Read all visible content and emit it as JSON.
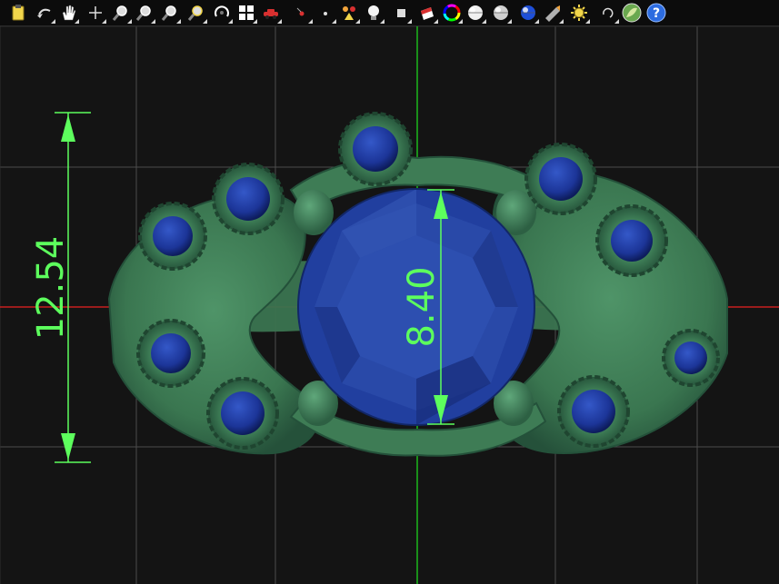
{
  "toolbar": {
    "items": [
      {
        "name": "clipboard-icon",
        "color": "#f2d64b"
      },
      {
        "name": "undo-arrow-icon",
        "color": "#dddddd"
      },
      {
        "name": "pan-hand-icon",
        "color": "#ffffff"
      },
      {
        "name": "move-cross-icon",
        "color": "#dddddd"
      },
      {
        "name": "zoom-in-icon",
        "color": "#ffffff"
      },
      {
        "name": "zoom-out-icon",
        "color": "#ffffff"
      },
      {
        "name": "zoom-extents-icon",
        "color": "#ffffff"
      },
      {
        "name": "zoom-selected-icon",
        "color": "#f2d64b"
      },
      {
        "name": "orbit-icon",
        "color": "#ffffff"
      },
      {
        "name": "four-viewports-icon",
        "color": "#ffffff"
      },
      {
        "name": "car-walk-icon",
        "color": "#d83030"
      },
      {
        "name": "point-icon",
        "color": "#d83030"
      },
      {
        "name": "dot-icon",
        "color": "#dddddd"
      },
      {
        "name": "snap-shapes-icon",
        "color": "#f2a43b"
      },
      {
        "name": "lightbulb-icon",
        "color": "#f4f4f4"
      },
      {
        "name": "shaded-box-icon",
        "color": "#dddddd"
      },
      {
        "name": "paint-bucket-icon",
        "color": "#d83030"
      },
      {
        "name": "color-wheel-icon",
        "color": "#ff00ff"
      },
      {
        "name": "white-sphere-icon",
        "color": "#f0f0f0"
      },
      {
        "name": "chrome-sphere-icon",
        "color": "#d0d0d0"
      },
      {
        "name": "blue-sphere-icon",
        "color": "#1e4fd8"
      },
      {
        "name": "metal-cone-icon",
        "color": "#b0b0b0"
      },
      {
        "name": "settings-sun-icon",
        "color": "#f2d64b"
      },
      {
        "name": "rotate-view-icon",
        "color": "#dddddd"
      },
      {
        "name": "render-leaf-icon",
        "color": "#6aa84f"
      },
      {
        "name": "help-icon",
        "color": "#2d6ce0"
      }
    ]
  },
  "viewport": {
    "dimensions": [
      {
        "label": "ring-width-dimension",
        "value": "12.54"
      },
      {
        "label": "stone-diameter-dimension",
        "value": "8.40"
      }
    ],
    "colors": {
      "background": "#151515",
      "grid": "#5a5a5a",
      "y_axis": "#1db81d",
      "x_axis": "#c81e1e",
      "metal": "#3f7e56",
      "stone": "#1f3ea0",
      "dimension": "#5dff5d"
    }
  }
}
